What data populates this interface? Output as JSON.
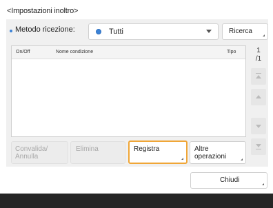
{
  "header": {
    "title": "<Impostazioni inoltro>"
  },
  "filter": {
    "label": "Metodo ricezione:",
    "selected": "Tutti",
    "search_button": "Ricerca"
  },
  "table": {
    "columns": [
      "On/Off",
      "Nome condizione",
      "Tipo"
    ],
    "rows": []
  },
  "pager": {
    "current": "1",
    "total": "/1"
  },
  "actions": {
    "convalida_line1": "Convalida/",
    "convalida_line2": "Annulla",
    "elimina": "Elimina",
    "registra": "Registra",
    "altre_line1": "Altre",
    "altre_line2": "operazioni"
  },
  "footer": {
    "close_button": "Chiudi"
  },
  "colors": {
    "accent": "#3b82d6",
    "focus": "#f0a637",
    "bottom_bar": "#262626"
  },
  "icons": [
    "radio-selected-icon",
    "chevron-down-icon",
    "scroll-top-icon",
    "scroll-up-icon",
    "scroll-down-icon",
    "scroll-bottom-icon"
  ]
}
